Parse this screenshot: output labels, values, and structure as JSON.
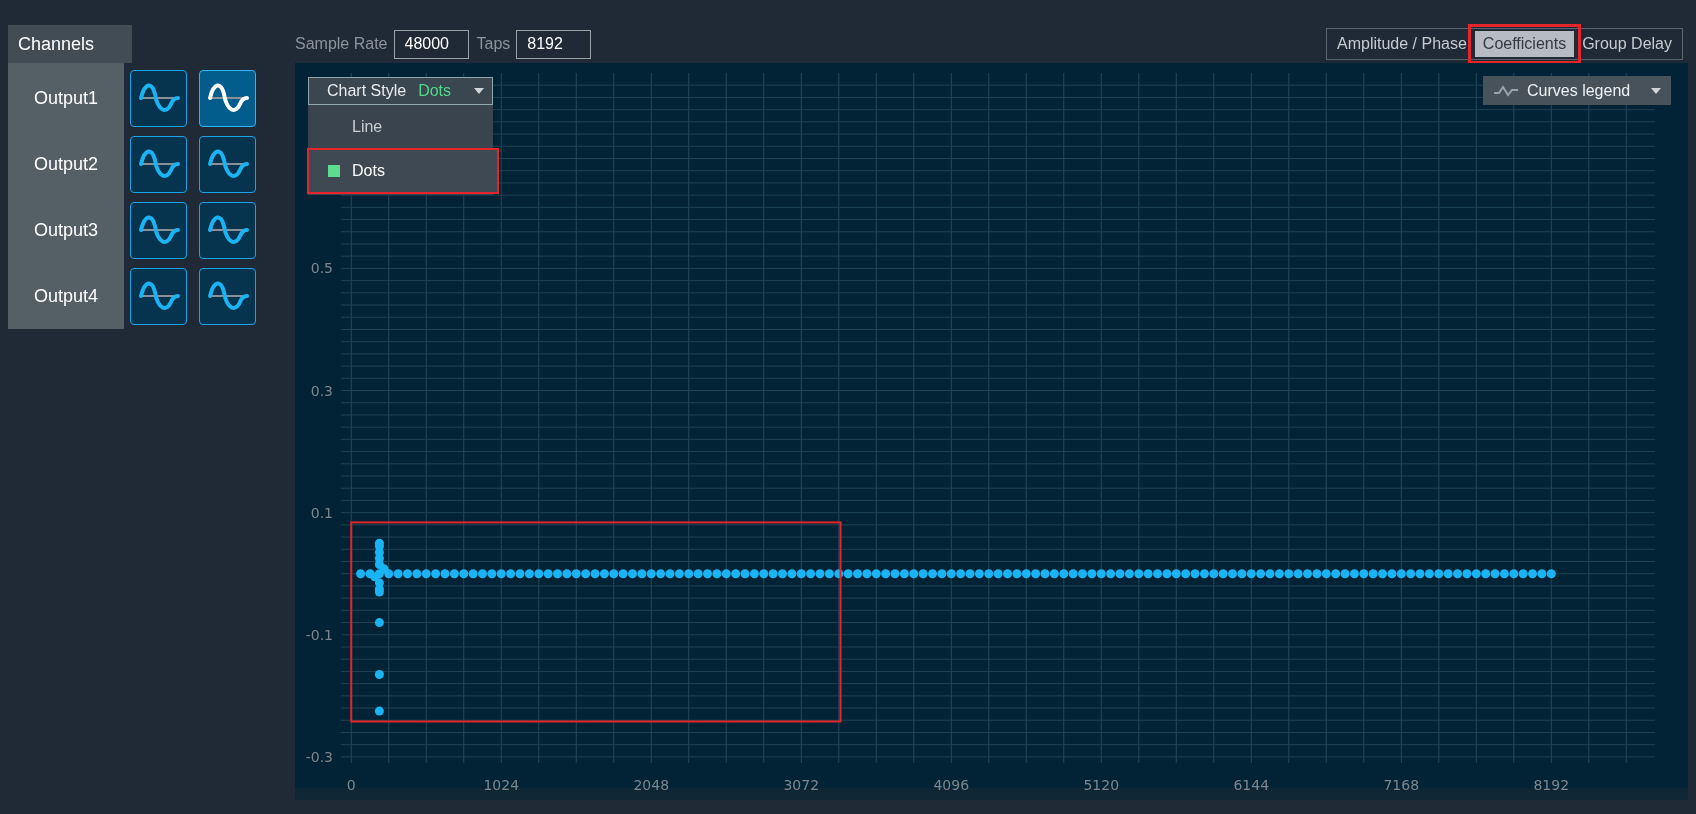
{
  "channels_panel": {
    "title": "Channels",
    "outputs": [
      {
        "label": "Output1",
        "buttons": [
          {
            "selected": false
          },
          {
            "selected": true
          }
        ]
      },
      {
        "label": "Output2",
        "buttons": [
          {
            "selected": false
          },
          {
            "selected": false
          }
        ]
      },
      {
        "label": "Output3",
        "buttons": [
          {
            "selected": false
          },
          {
            "selected": false
          }
        ]
      },
      {
        "label": "Output4",
        "buttons": [
          {
            "selected": false
          },
          {
            "selected": false
          }
        ]
      }
    ]
  },
  "toolbar": {
    "sample_rate": {
      "label": "Sample Rate",
      "value": "48000"
    },
    "taps": {
      "label": "Taps",
      "value": "8192"
    }
  },
  "view_tabs": [
    {
      "label": "Amplitude / Phase",
      "selected": false,
      "highlighted": false
    },
    {
      "label": "Coefficients",
      "selected": true,
      "highlighted": true
    },
    {
      "label": "Group Delay",
      "selected": false,
      "highlighted": false
    }
  ],
  "chart_style": {
    "label": "Chart Style",
    "value": "Dots",
    "options": [
      {
        "label": "Line",
        "selected": false,
        "highlighted": false
      },
      {
        "label": "Dots",
        "selected": true,
        "highlighted": true
      }
    ]
  },
  "curves_legend": {
    "label": "Curves legend"
  },
  "chart_data": {
    "type": "scatter",
    "xlim": [
      -70,
      8900
    ],
    "ylim": [
      -0.31,
      0.82
    ],
    "xticks": [
      0,
      1024,
      2048,
      3072,
      4096,
      5120,
      6144,
      7168,
      8192
    ],
    "yticks": [
      0.5,
      0.3,
      0.1,
      -0.1,
      -0.3
    ],
    "x": [
      64,
      128,
      160,
      192,
      192,
      192,
      192,
      192,
      192,
      192,
      192,
      192,
      192,
      192,
      192,
      224,
      256,
      320,
      384,
      448,
      512,
      576,
      640,
      704,
      768,
      832,
      896,
      960,
      1024,
      1088,
      1152,
      1216,
      1280,
      1344,
      1408,
      1472,
      1536,
      1600,
      1664,
      1728,
      1792,
      1856,
      1920,
      1984,
      2048,
      2112,
      2176,
      2240,
      2304,
      2368,
      2432,
      2496,
      2560,
      2624,
      2688,
      2752,
      2816,
      2880,
      2944,
      3008,
      3072,
      3136,
      3200,
      3264,
      3328,
      3392,
      3456,
      3520,
      3584,
      3648,
      3712,
      3776,
      3840,
      3904,
      3968,
      4032,
      4096,
      4160,
      4224,
      4288,
      4352,
      4416,
      4480,
      4544,
      4608,
      4672,
      4736,
      4800,
      4864,
      4928,
      4992,
      5056,
      5120,
      5184,
      5248,
      5312,
      5376,
      5440,
      5504,
      5568,
      5632,
      5696,
      5760,
      5824,
      5888,
      5952,
      6016,
      6080,
      6144,
      6208,
      6272,
      6336,
      6400,
      6464,
      6528,
      6592,
      6656,
      6720,
      6784,
      6848,
      6912,
      6976,
      7040,
      7104,
      7168,
      7232,
      7296,
      7360,
      7424,
      7488,
      7552,
      7616,
      7680,
      7744,
      7808,
      7872,
      7936,
      8000,
      8064,
      8128,
      8192
    ],
    "series": [
      {
        "color": "#1ab4f5",
        "values": [
          0,
          0,
          -0.005,
          0.05,
          0.045,
          0.035,
          0.025,
          0.015,
          0,
          -0.015,
          -0.025,
          -0.03,
          -0.08,
          -0.165,
          -0.225,
          0.008,
          0,
          0,
          0,
          0,
          0,
          0,
          0,
          0,
          0,
          0,
          0,
          0,
          0,
          0,
          0,
          0,
          0,
          0,
          0,
          0,
          0,
          0,
          0,
          0,
          0,
          0,
          0,
          0,
          0,
          0,
          0,
          0,
          0,
          0,
          0,
          0,
          0,
          0,
          0,
          0,
          0,
          0,
          0,
          0,
          0,
          0,
          0,
          0,
          0,
          0,
          0,
          0,
          0,
          0,
          0,
          0,
          0,
          0,
          0,
          0,
          0,
          0,
          0,
          0,
          0,
          0,
          0,
          0,
          0,
          0,
          0,
          0,
          0,
          0,
          0,
          0,
          0,
          0,
          0,
          0,
          0,
          0,
          0,
          0,
          0,
          0,
          0,
          0,
          0,
          0,
          0,
          0,
          0,
          0,
          0,
          0,
          0,
          0,
          0,
          0,
          0,
          0,
          0,
          0,
          0,
          0,
          0,
          0,
          0,
          0,
          0,
          0,
          0,
          0,
          0,
          0,
          0,
          0,
          0,
          0,
          0,
          0,
          0,
          0,
          0
        ]
      }
    ],
    "grid": true
  },
  "chart_highlight": true
}
